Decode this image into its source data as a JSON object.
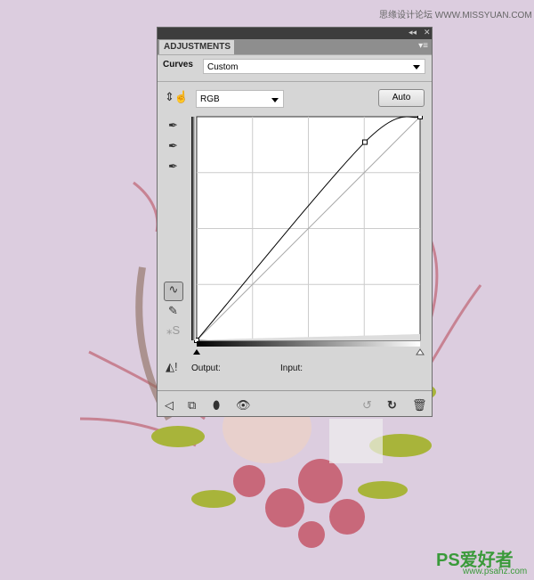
{
  "watermarks": {
    "top": "思缘设计论坛 WWW.MISSYUAN.COM",
    "bottom_brand": "PS爱好者",
    "bottom_url": "www.psahz.com"
  },
  "panel": {
    "tab": "ADJUSTMENTS",
    "title": "Curves",
    "preset": "Custom",
    "channel": "RGB",
    "auto_label": "Auto",
    "output_label": "Output:",
    "input_label": "Input:"
  },
  "curve": {
    "points": [
      [
        0,
        0
      ],
      [
        192,
        226
      ],
      [
        255,
        255
      ]
    ],
    "range": [
      0,
      255
    ]
  },
  "icons": [
    "collapse-icon",
    "close-icon",
    "panel-menu-icon",
    "on-image-adjust-icon",
    "eyedropper-black-icon",
    "eyedropper-gray-icon",
    "eyedropper-white-icon",
    "curve-tool-icon",
    "pencil-icon",
    "smooth-icon",
    "clipping-warning-icon",
    "back-arrow-icon",
    "clip-layer-icon",
    "mask-icon",
    "visibility-icon",
    "previous-state-icon",
    "reset-icon",
    "trash-icon"
  ],
  "colors": {
    "background": "#dccddf",
    "panel": "#d6d6d6",
    "petals": "#c8687a",
    "leaves": "#a8b43a"
  }
}
